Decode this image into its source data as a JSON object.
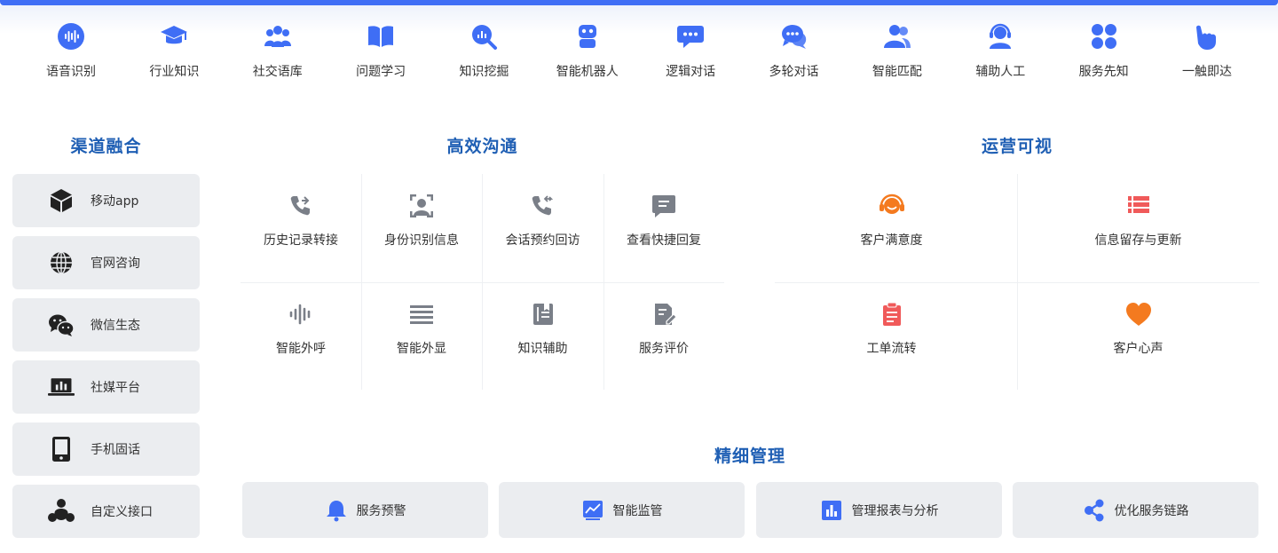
{
  "features": [
    {
      "label": "语音识别",
      "icon": "voice-recognition-icon"
    },
    {
      "label": "行业知识",
      "icon": "graduation-cap-icon"
    },
    {
      "label": "社交语库",
      "icon": "group-icon"
    },
    {
      "label": "问题学习",
      "icon": "book-icon"
    },
    {
      "label": "知识挖掘",
      "icon": "search-chart-icon"
    },
    {
      "label": "智能机器人",
      "icon": "robot-icon"
    },
    {
      "label": "逻辑对话",
      "icon": "chat-bubble-icon"
    },
    {
      "label": "多轮对话",
      "icon": "multi-chat-icon"
    },
    {
      "label": "智能匹配",
      "icon": "users-icon"
    },
    {
      "label": "辅助人工",
      "icon": "headset-agent-icon"
    },
    {
      "label": "服务先知",
      "icon": "clover-icon"
    },
    {
      "label": "一触即达",
      "icon": "tap-hand-icon"
    }
  ],
  "sections": {
    "channels": "渠道融合",
    "communication": "高效沟通",
    "operations": "运营可视",
    "management": "精细管理"
  },
  "channels": [
    {
      "label": "移动app",
      "icon": "cube-icon"
    },
    {
      "label": "官网咨询",
      "icon": "globe-icon"
    },
    {
      "label": "微信生态",
      "icon": "wechat-icon"
    },
    {
      "label": "社媒平台",
      "icon": "laptop-chart-icon"
    },
    {
      "label": "手机固话",
      "icon": "phone-device-icon"
    },
    {
      "label": "自定义接口",
      "icon": "network-icon"
    }
  ],
  "communication": [
    {
      "label": "历史记录转接",
      "icon": "phone-transfer-icon"
    },
    {
      "label": "身份识别信息",
      "icon": "face-id-icon"
    },
    {
      "label": "会话预约回访",
      "icon": "phone-callback-icon"
    },
    {
      "label": "查看快捷回复",
      "icon": "message-icon"
    },
    {
      "label": "智能外呼",
      "icon": "sound-wave-icon"
    },
    {
      "label": "智能外显",
      "icon": "lines-icon"
    },
    {
      "label": "知识辅助",
      "icon": "notebook-icon"
    },
    {
      "label": "服务评价",
      "icon": "edit-doc-icon"
    }
  ],
  "operations": [
    {
      "label": "客户满意度",
      "icon": "customer-service-icon",
      "color": "#f47a1f"
    },
    {
      "label": "信息留存与更新",
      "icon": "list-icon",
      "color": "#f05a5a"
    },
    {
      "label": "工单流转",
      "icon": "clipboard-icon",
      "color": "#f05a5a"
    },
    {
      "label": "客户心声",
      "icon": "heart-icon",
      "color": "#f47a1f"
    }
  ],
  "management": [
    {
      "label": "服务预警",
      "icon": "bell-icon"
    },
    {
      "label": "智能监管",
      "icon": "monitor-chart-icon"
    },
    {
      "label": "管理报表与分析",
      "icon": "bar-chart-icon"
    },
    {
      "label": "优化服务链路",
      "icon": "share-nodes-icon"
    }
  ],
  "colors": {
    "accent": "#3f6ef5",
    "title": "#1f5fb4",
    "tile": "#ebedf0",
    "grey_icon": "#7a7f88",
    "dark_icon": "#222222"
  }
}
